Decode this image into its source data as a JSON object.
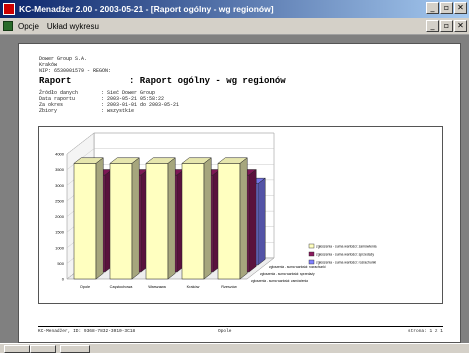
{
  "window": {
    "title": "KC-Menadżer 2.00 - 2003-05-21 - [Raport ogólny - wg regionów]",
    "min": "_",
    "max": "▫",
    "close": "✕"
  },
  "menu": {
    "items": [
      {
        "label": "Opcje"
      },
      {
        "label": "Układ wykresu"
      }
    ]
  },
  "report": {
    "company": "Dower Group S.A.",
    "city": "Kraków",
    "nip": "NIP: 6530001579 - REGON:",
    "title_label": "Raport",
    "title_value": ": Raport ogólny - wg regionów",
    "fields": [
      {
        "label": "Źródło danych",
        "value": ": Sieć Dower Group"
      },
      {
        "label": "Data raportu",
        "value": ": 2003-05-21 05:58:22"
      },
      {
        "label": "Za okres",
        "value": ": 2003-01-01 do 2003-05-21"
      },
      {
        "label": "Zbiory",
        "value": ": wszystkie"
      }
    ]
  },
  "chart_data": {
    "type": "bar",
    "title": "",
    "categories": [
      "Opole",
      "Częstochowa",
      "Warszawa",
      "Kraków",
      "Rzeszów"
    ],
    "yticks": [
      "4000",
      "3500",
      "3000",
      "2500",
      "2000",
      "1500",
      "1000",
      "500",
      "0"
    ],
    "ylim": [
      0,
      4000
    ],
    "series": [
      {
        "name": "zgłoszenia - suma wartości: zamówienia",
        "values": [
          3700,
          3700,
          3700,
          3700,
          3700
        ],
        "color": "#ffffc0"
      },
      {
        "name": "zgłoszenia - suma wartości: sprzedaży",
        "values": [
          3100,
          3100,
          3100,
          3100,
          3100
        ],
        "color": "#8b1a5e"
      },
      {
        "name": "zgłoszenia - suma wartości: rozrachunki",
        "values": [
          2600,
          2600,
          2600,
          2600,
          2600
        ],
        "color": "#8080ff"
      }
    ],
    "legend": "right"
  },
  "footer": {
    "left": "KC-Menadżer, ID: 9368-7832-3010-3C18",
    "center": "Opole",
    "right": "strona: 1 z 1"
  }
}
